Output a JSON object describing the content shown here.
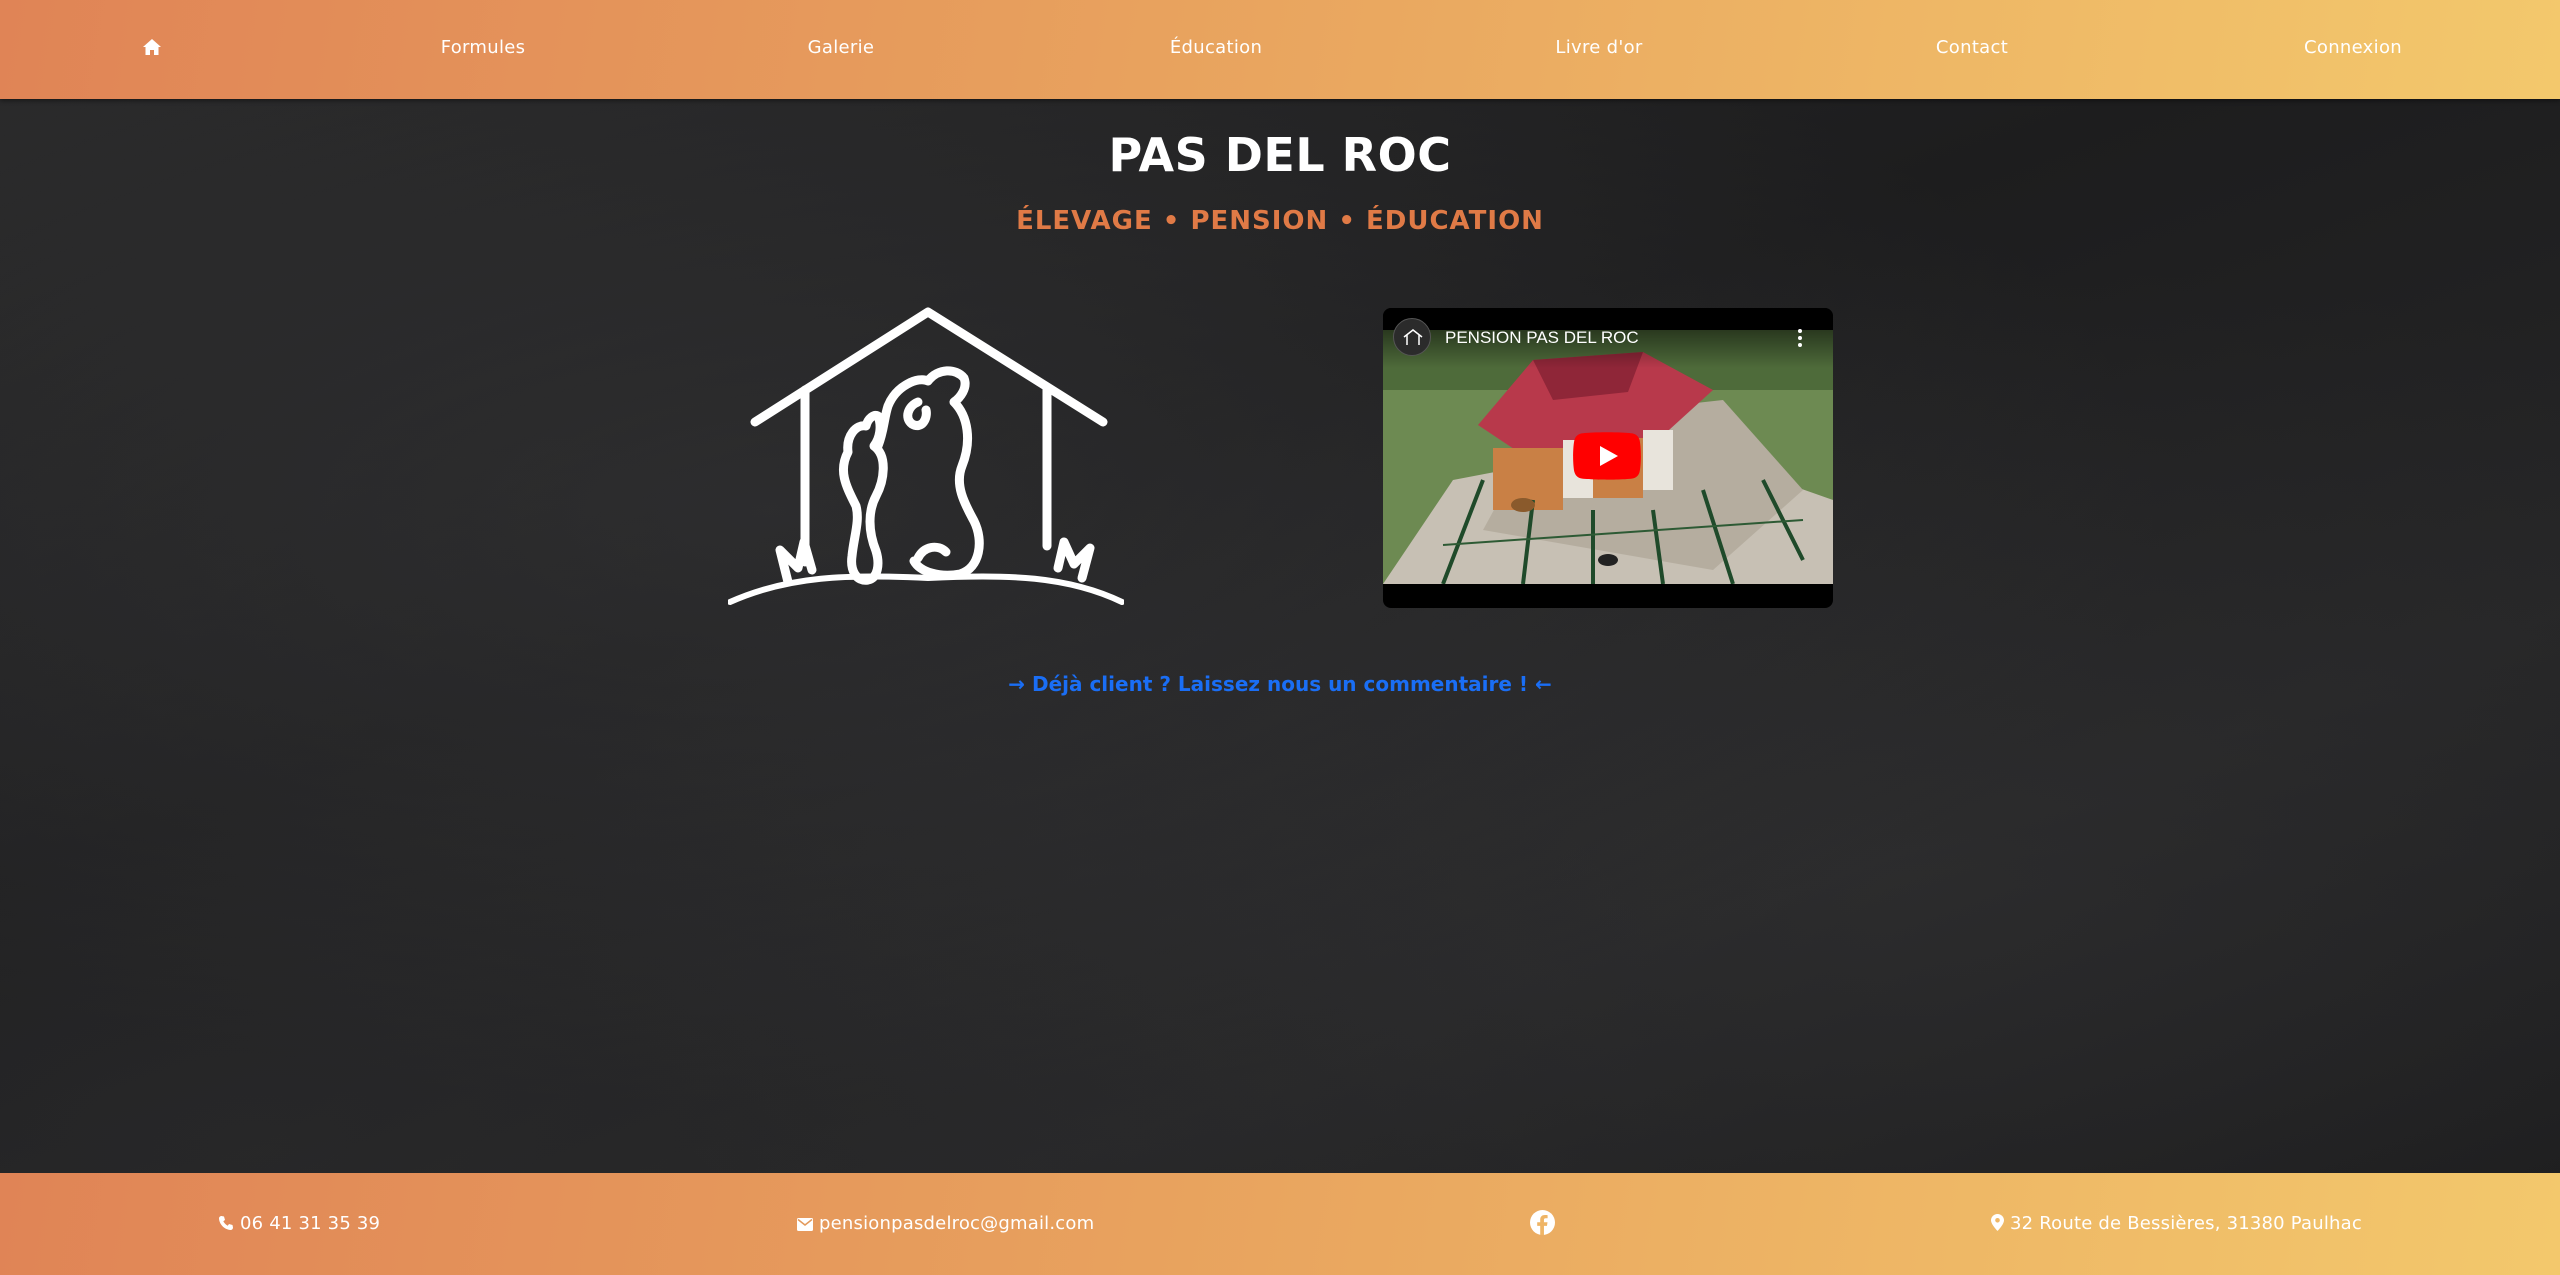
{
  "nav": {
    "home_icon": "home-icon",
    "items": [
      "Formules",
      "Galerie",
      "Éducation",
      "Livre d'or",
      "Contact",
      "Connexion"
    ]
  },
  "hero": {
    "title": "PAS DEL ROC",
    "subtitle": "ÉLEVAGE • PENSION • ÉDUCATION",
    "logo_icon": "doghouse-dog-cat-logo"
  },
  "video": {
    "title": "PENSION PAS DEL ROC",
    "channel_icon": "channel-avatar-icon",
    "play_icon": "youtube-play-icon",
    "menu_icon": "more-vert-icon"
  },
  "review_link": "→ Déjà client ? Laissez nous un commentaire ! ←",
  "footer": {
    "phone": "06 41 31 35 39",
    "email": "pensionpasdelroc@gmail.com",
    "facebook_icon": "facebook-icon",
    "address": "32 Route de Bessières, 31380 Paulhac"
  },
  "colors": {
    "gradient_start": "#e08456",
    "gradient_end": "#f3c86c",
    "subtitle": "#e07a46",
    "link": "#1a6ef5",
    "background": "#1e1e1f"
  }
}
